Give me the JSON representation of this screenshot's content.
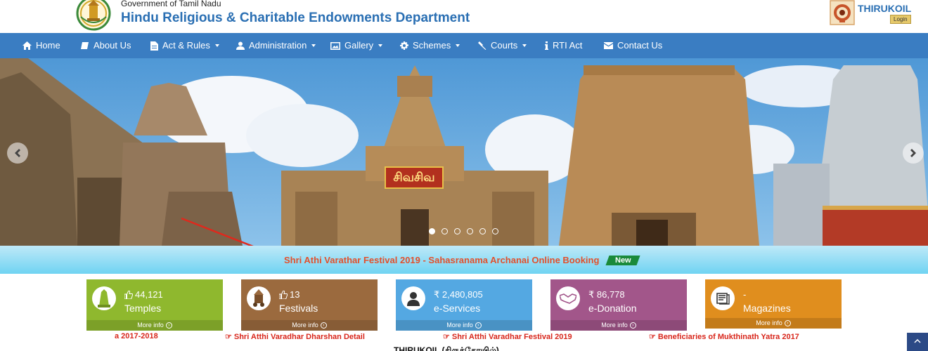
{
  "header": {
    "government": "Government of Tamil Nadu",
    "department": "Hindu Religious & Charitable Endowments Department",
    "thirukoil": "THIRUKOIL",
    "login": "Login"
  },
  "nav": {
    "items": [
      {
        "label": "Home",
        "icon": "home-icon"
      },
      {
        "label": "About Us",
        "icon": "book-icon"
      },
      {
        "label": "Act & Rules",
        "icon": "document-icon",
        "dropdown": true
      },
      {
        "label": "Administration",
        "icon": "user-icon",
        "dropdown": true
      },
      {
        "label": "Gallery",
        "icon": "image-icon",
        "dropdown": true
      },
      {
        "label": "Schemes",
        "icon": "gear-icon",
        "dropdown": true
      },
      {
        "label": "Courts",
        "icon": "gavel-icon",
        "dropdown": true
      },
      {
        "label": "RTI Act",
        "icon": "info-icon"
      },
      {
        "label": "Contact Us",
        "icon": "envelope-icon"
      }
    ]
  },
  "slider": {
    "banner_text": "சிவசிவ",
    "slide_count": 6,
    "active_slide": 1
  },
  "news": {
    "headline": "Shri Athi Varathar Festival 2019 - Sahasranama Archanai Online Booking",
    "badge": "New"
  },
  "cards": [
    {
      "count": "44,121",
      "count_icon": "thumbs-up-icon",
      "label": "Temples",
      "more": "More info",
      "color": "#8fb82e"
    },
    {
      "count": "13",
      "count_icon": "thumbs-up-icon",
      "label": "Festivals",
      "more": "More info",
      "color": "#9b6a3e"
    },
    {
      "count": "₹ 2,480,805",
      "count_icon": "rupee-icon",
      "label": "e-Services",
      "more": "More info",
      "color": "#54a8e2"
    },
    {
      "count": "₹ 86,778",
      "count_icon": "rupee-icon",
      "label": "e-Donation",
      "more": "More info",
      "color": "#a2568a"
    },
    {
      "count": "-",
      "count_icon": "",
      "label": "Magazines",
      "more": "More info",
      "color": "#e08e1e"
    }
  ],
  "ticker": {
    "items": [
      "a 2017-2018",
      "Shri Atthi Varadhar Dharshan Detail",
      "Shri Atthi Varadhar Festival 2019",
      "Beneficiaries of Mukthinath Yatra 2017"
    ]
  },
  "footer": {
    "title": "THIRUKOIL (திருக்கோயில்)"
  }
}
